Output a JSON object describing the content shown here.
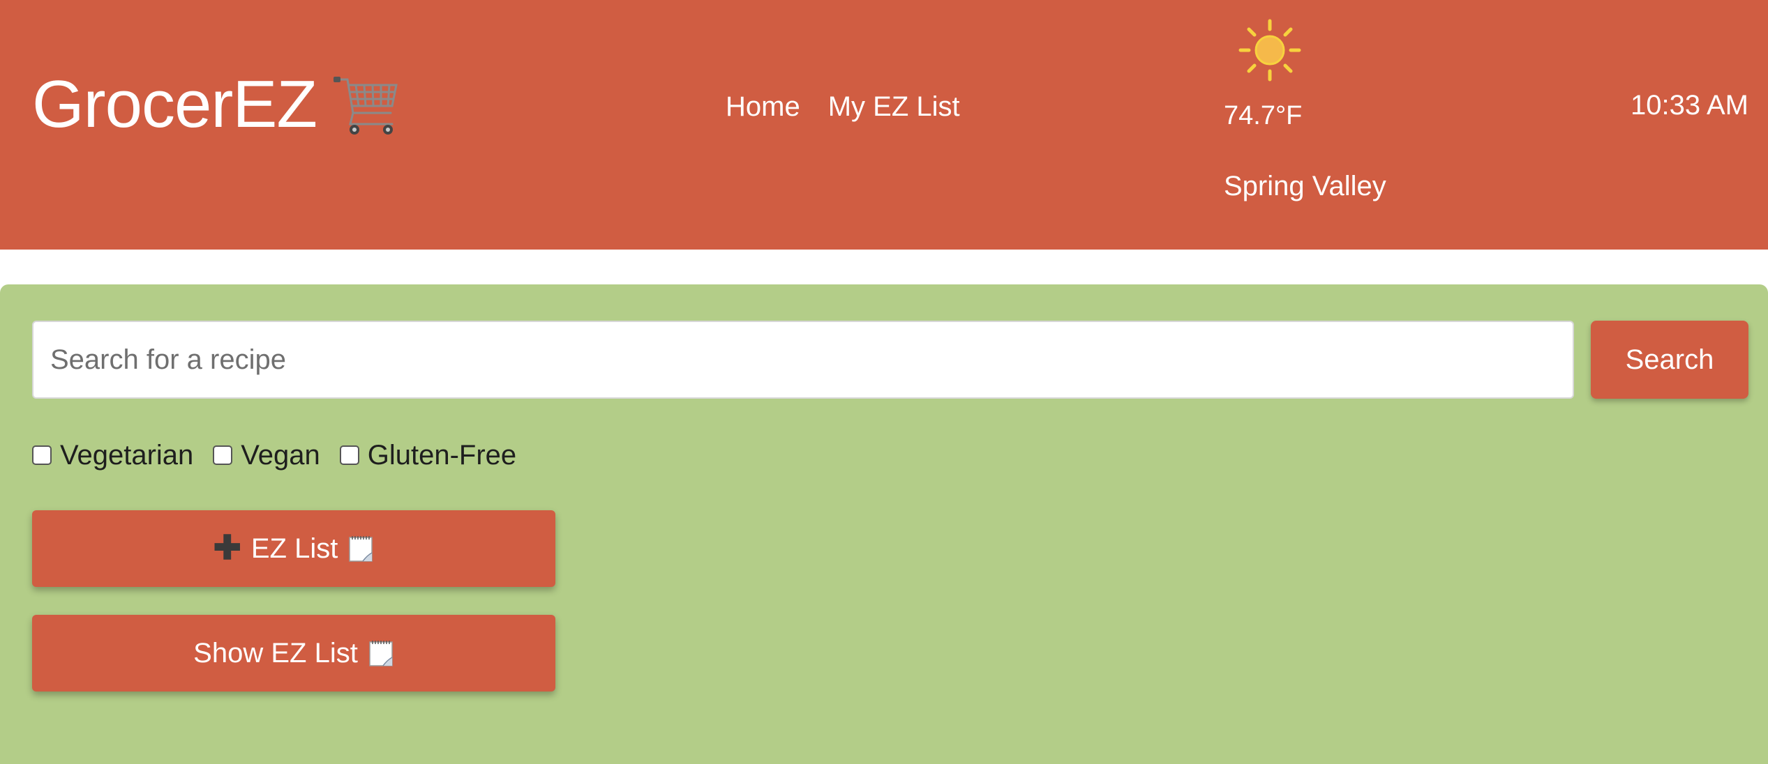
{
  "header": {
    "brand_title": "GrocerEZ",
    "brand_icon": "shopping-cart-icon",
    "nav": [
      {
        "label": "Home"
      },
      {
        "label": "My EZ List"
      }
    ],
    "weather": {
      "icon": "sun-icon",
      "temperature": "74.7°F",
      "city": "Spring Valley"
    },
    "time": "10:33 AM"
  },
  "search": {
    "placeholder": "Search for a recipe",
    "value": "",
    "button_label": "Search"
  },
  "filters": [
    {
      "label": "Vegetarian",
      "checked": false
    },
    {
      "label": "Vegan",
      "checked": false
    },
    {
      "label": "Gluten-Free",
      "checked": false
    }
  ],
  "actions": {
    "add_list_label": "EZ List",
    "add_list_icon": "plus-icon",
    "show_list_label": "Show EZ List",
    "list_icon": "notepad-icon"
  },
  "colors": {
    "header_bg": "#d05d42",
    "main_bg": "#b3cd88",
    "button_bg": "#d05d42",
    "sun": "#f5b94a"
  }
}
